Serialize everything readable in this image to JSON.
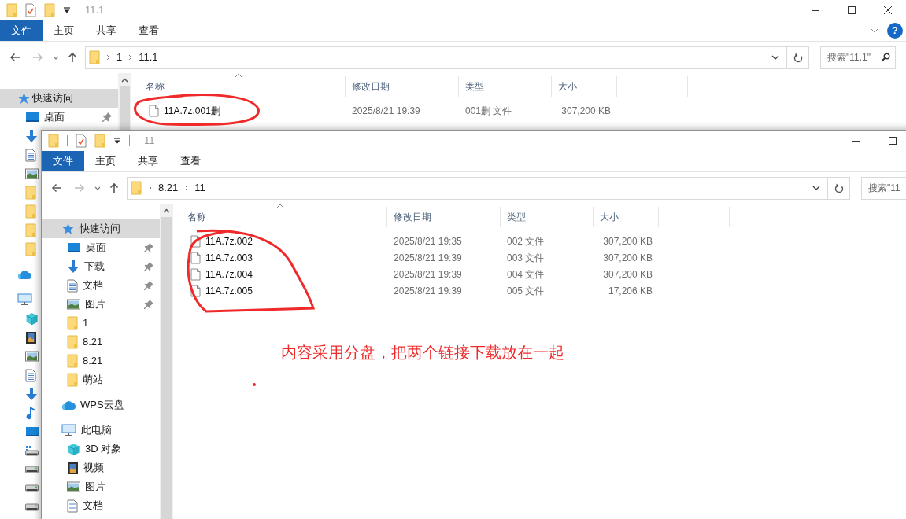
{
  "windows": [
    {
      "title": "11.1",
      "quick_access_toolbar": [
        {
          "kind": "folder"
        },
        {
          "kind": "properties"
        },
        {
          "kind": "folder"
        },
        {
          "kind": "customize"
        }
      ],
      "window_buttons": [
        {
          "kind": "minimize"
        },
        {
          "kind": "maximize"
        },
        {
          "kind": "close"
        }
      ],
      "ribbon_tabs": [
        {
          "label": "文件",
          "kind": "file"
        },
        {
          "label": "主页",
          "kind": "tab"
        },
        {
          "label": "共享",
          "kind": "tab"
        },
        {
          "label": "查看",
          "kind": "tab"
        }
      ],
      "ribbon_tools": [
        {
          "kind": "collapse"
        },
        {
          "kind": "help",
          "label": "?"
        }
      ],
      "breadcrumbs": [
        "1",
        "11.1"
      ],
      "search": {
        "placeholder": "搜索\"11.1\""
      },
      "sidebar": [
        {
          "label": "快速访问",
          "kind": "star",
          "selected": true,
          "children": [
            {
              "label": "桌面",
              "kind": "desktop",
              "pinned": true,
              "selected": false
            },
            {
              "kind": "download"
            },
            {
              "kind": "doc"
            },
            {
              "kind": "picture"
            },
            {
              "kind": "folder"
            },
            {
              "kind": "folder"
            },
            {
              "kind": "folder"
            },
            {
              "kind": "folder"
            }
          ]
        },
        {
          "kind": "cloud"
        },
        {
          "kind": "pc",
          "children": [
            {
              "kind": "cube"
            },
            {
              "kind": "video"
            },
            {
              "kind": "picture"
            },
            {
              "kind": "doc"
            },
            {
              "kind": "download"
            },
            {
              "kind": "music"
            },
            {
              "kind": "desktop"
            },
            {
              "kind": "system-drive"
            },
            {
              "kind": "drive"
            },
            {
              "kind": "drive"
            },
            {
              "kind": "drive"
            }
          ]
        }
      ],
      "columns": [
        "名称",
        "修改日期",
        "类型",
        "大小"
      ],
      "files": [
        {
          "name": "11A.7z.001删",
          "modified": "2025/8/21 19:39",
          "type": "001删 文件",
          "size": "307,200 KB"
        }
      ]
    },
    {
      "title": "11",
      "quick_access_toolbar": [
        {
          "kind": "folder"
        },
        {
          "kind": "separator"
        },
        {
          "kind": "properties"
        },
        {
          "kind": "folder"
        },
        {
          "kind": "customize"
        },
        {
          "kind": "separator"
        }
      ],
      "window_buttons": [
        {
          "kind": "minimize"
        },
        {
          "kind": "maximize"
        }
      ],
      "ribbon_tabs": [
        {
          "label": "文件",
          "kind": "file"
        },
        {
          "label": "主页",
          "kind": "tab"
        },
        {
          "label": "共享",
          "kind": "tab"
        },
        {
          "label": "查看",
          "kind": "tab"
        }
      ],
      "breadcrumbs": [
        "8.21",
        "11"
      ],
      "search": {
        "placeholder": "搜索\"11"
      },
      "sidebar": [
        {
          "label": "快速访问",
          "kind": "star",
          "selected": true,
          "children": [
            {
              "label": "桌面",
              "kind": "desktop",
              "pinned": true,
              "selected": false
            },
            {
              "label": "下载",
              "kind": "download",
              "pinned": true,
              "selected": false
            },
            {
              "label": "文档",
              "kind": "doc",
              "pinned": true,
              "selected": false
            },
            {
              "label": "图片",
              "kind": "picture",
              "pinned": true,
              "selected": false
            },
            {
              "label": "1",
              "kind": "folder",
              "pinned": false,
              "selected": false
            },
            {
              "label": "8.21",
              "kind": "folder",
              "pinned": false,
              "selected": false
            },
            {
              "label": "8.21",
              "kind": "folder",
              "pinned": false,
              "selected": false
            },
            {
              "label": "萌站",
              "kind": "folder",
              "pinned": false,
              "selected": false
            }
          ]
        },
        {
          "label": "WPS云盘",
          "kind": "cloud",
          "selected": false
        },
        {
          "label": "此电脑",
          "kind": "pc",
          "selected": false,
          "children": [
            {
              "label": "3D 对象",
              "kind": "cube",
              "selected": false
            },
            {
              "label": "视频",
              "kind": "video",
              "selected": false
            },
            {
              "label": "图片",
              "kind": "picture",
              "selected": false
            },
            {
              "label": "文档",
              "kind": "doc",
              "selected": false
            }
          ]
        }
      ],
      "columns": [
        "名称",
        "修改日期",
        "类型",
        "大小"
      ],
      "files": [
        {
          "name": "11A.7z.002",
          "modified": "2025/8/21 19:35",
          "type": "002 文件",
          "size": "307,200 KB"
        },
        {
          "name": "11A.7z.003",
          "modified": "2025/8/21 19:39",
          "type": "003 文件",
          "size": "307,200 KB"
        },
        {
          "name": "11A.7z.004",
          "modified": "2025/8/21 19:39",
          "type": "004 文件",
          "size": "307,200 KB"
        },
        {
          "name": "11A.7z.005",
          "modified": "2025/8/21 19:39",
          "type": "005 文件",
          "size": "17,206 KB"
        }
      ]
    }
  ],
  "annotation": {
    "text": "内容采用分盘，把两个链接下载放在一起"
  }
}
